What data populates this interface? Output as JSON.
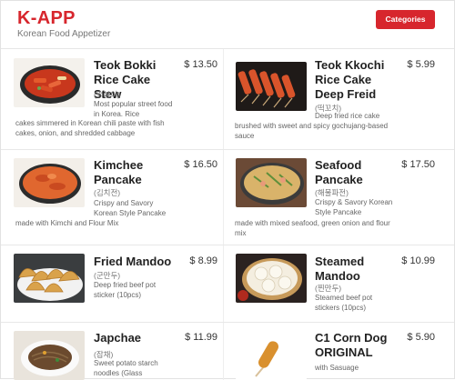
{
  "header": {
    "brand": "K-APP",
    "subtitle": "Korean Food Appetizer",
    "categories_button": "Categories",
    "accent": "#d7262d"
  },
  "items": [
    {
      "name": "Teok Bokki Rice Cake Stew",
      "price": "$ 13.50",
      "native": "(떡볶이)",
      "desc_top": "Most popular street food in Korea. Rice",
      "desc_bottom": "cakes simmered in Korean chili paste with fish cakes, onion, and shredded cabbage"
    },
    {
      "name": "Teok Kkochi Rice Cake Deep Freid",
      "price": "$ 5.99",
      "native": "(떡꼬치)",
      "desc_top": "Deep fried rice cake",
      "desc_bottom": "brushed with sweet and spicy gochujang-based sauce"
    },
    {
      "name": "Kimchee Pancake",
      "price": "$ 16.50",
      "native": "(김치전)",
      "desc_top": "Crispy and Savory Korean Style Pancake",
      "desc_bottom": "made with Kimchi and Flour Mix"
    },
    {
      "name": "Seafood Pancake",
      "price": "$ 17.50",
      "native": "(해물파전)",
      "desc_top": "Crispy & Savory Korean Style Pancake",
      "desc_bottom": "made with mixed seafood, green onion and flour mix"
    },
    {
      "name": "Fried Mandoo",
      "price": "$ 8.99",
      "native": "(군만두)",
      "desc_top": "Deep fried beef pot sticker (10pcs)",
      "desc_bottom": ""
    },
    {
      "name": "Steamed Mandoo",
      "price": "$ 10.99",
      "native": "(찐만두)",
      "desc_top": "Steamed beef pot stickers (10pcs)",
      "desc_bottom": ""
    },
    {
      "name": "Japchae",
      "price": "$ 11.99",
      "native": "(잡채)",
      "desc_top": "Sweet potato starch noodles (Glass",
      "desc_bottom": ""
    },
    {
      "name": "C1 Corn Dog ORIGINAL",
      "price": "$ 5.90",
      "native": "",
      "desc_top": "with Sasuage",
      "desc_bottom": ""
    }
  ]
}
